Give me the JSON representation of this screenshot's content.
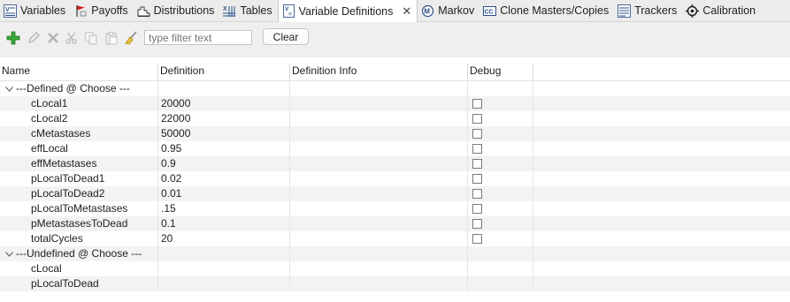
{
  "tabs": [
    {
      "label": "Variables",
      "icon": "variables-icon"
    },
    {
      "label": "Payoffs",
      "icon": "payoffs-flag-icon"
    },
    {
      "label": "Distributions",
      "icon": "distributions-icon"
    },
    {
      "label": "Tables",
      "icon": "tables-icon"
    },
    {
      "label": "Variable Definitions",
      "icon": "variable-definitions-icon",
      "active": true
    },
    {
      "label": "Markov",
      "icon": "markov-icon"
    },
    {
      "label": "Clone Masters/Copies",
      "icon": "clone-masters-icon"
    },
    {
      "label": "Trackers",
      "icon": "trackers-icon"
    },
    {
      "label": "Calibration",
      "icon": "calibration-target-icon"
    }
  ],
  "toolbar": {
    "filter_placeholder": "type filter text",
    "clear_label": "Clear"
  },
  "columns": {
    "name": "Name",
    "definition": "Definition",
    "definition_info": "Definition Info",
    "debug": "Debug"
  },
  "groups": [
    {
      "label": "---Defined @ Choose ---",
      "rows": [
        {
          "name": "cLocal1",
          "definition": "20000",
          "debug": false
        },
        {
          "name": "cLocal2",
          "definition": "22000",
          "debug": false
        },
        {
          "name": "cMetastases",
          "definition": "50000",
          "debug": false
        },
        {
          "name": "effLocal",
          "definition": "0.95",
          "debug": false
        },
        {
          "name": "effMetastases",
          "definition": "0.9",
          "debug": false
        },
        {
          "name": "pLocalToDead1",
          "definition": "0.02",
          "debug": false
        },
        {
          "name": "pLocalToDead2",
          "definition": "0.01",
          "debug": false
        },
        {
          "name": "pLocalToMetastases",
          "definition": ".15",
          "debug": false
        },
        {
          "name": "pMetastasesToDead",
          "definition": "0.1",
          "debug": false
        },
        {
          "name": "totalCycles",
          "definition": "20",
          "debug": false
        }
      ]
    },
    {
      "label": "---Undefined @ Choose ---",
      "rows": [
        {
          "name": "cLocal",
          "definition": "",
          "debug": null
        },
        {
          "name": "pLocalToDead",
          "definition": "",
          "debug": null
        }
      ]
    }
  ]
}
